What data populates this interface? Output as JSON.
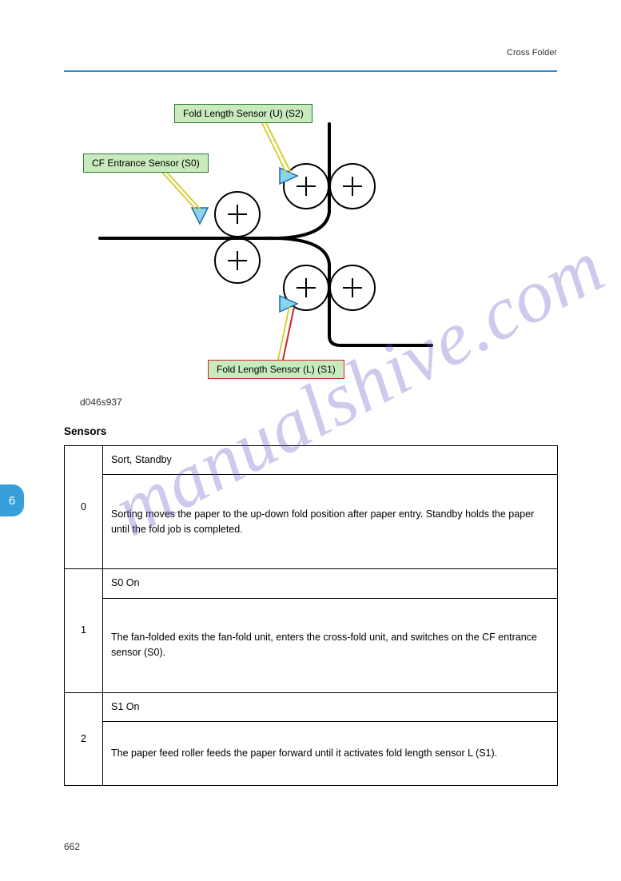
{
  "header": {
    "section_title": "Cross Folder"
  },
  "figure": {
    "label_upper": "Fold Length Sensor (U) (S2)",
    "label_entrance": "CF Entrance Sensor (S0)",
    "label_lower": "Fold Length Sensor (L) (S1)",
    "figure_id": "d046s937"
  },
  "sensors_heading": "Sensors",
  "side_tab": "6",
  "table": {
    "rows": [
      {
        "step": "0",
        "title": "Sort, Standby",
        "detail": "Sorting moves the paper to the up-down fold position after paper entry. Standby holds the paper until the fold job is completed."
      },
      {
        "step": "1",
        "title": "S0 On",
        "detail": "The fan-folded exits the fan-fold unit, enters the cross-fold unit, and switches on the CF entrance sensor (S0)."
      },
      {
        "step": "2",
        "title": "S1 On",
        "detail": "The paper feed roller feeds the paper forward until it activates fold length sensor L (S1)."
      }
    ]
  },
  "footer": {
    "page_number": "662"
  },
  "watermark": "manualshive.com"
}
